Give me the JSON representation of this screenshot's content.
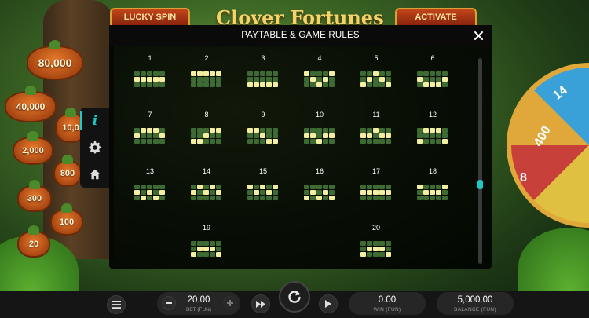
{
  "modal": {
    "title": "PAYTABLE & GAME RULES",
    "close_icon": "close-icon",
    "scroll_position": 0.62,
    "colors": {
      "active": "#f4eea0",
      "inactive": "#3e6a34",
      "accent": "#1ec8c8"
    }
  },
  "paylines": [
    {
      "number": "1",
      "rows": [
        [
          0,
          0,
          0,
          0,
          0
        ],
        [
          1,
          1,
          1,
          1,
          1
        ],
        [
          0,
          0,
          0,
          0,
          0
        ]
      ]
    },
    {
      "number": "2",
      "rows": [
        [
          1,
          1,
          1,
          1,
          1
        ],
        [
          0,
          0,
          0,
          0,
          0
        ],
        [
          0,
          0,
          0,
          0,
          0
        ]
      ]
    },
    {
      "number": "3",
      "rows": [
        [
          0,
          0,
          0,
          0,
          0
        ],
        [
          0,
          0,
          0,
          0,
          0
        ],
        [
          1,
          1,
          1,
          1,
          1
        ]
      ]
    },
    {
      "number": "4",
      "rows": [
        [
          1,
          0,
          0,
          0,
          1
        ],
        [
          0,
          1,
          0,
          1,
          0
        ],
        [
          0,
          0,
          1,
          0,
          0
        ]
      ]
    },
    {
      "number": "5",
      "rows": [
        [
          0,
          0,
          1,
          0,
          0
        ],
        [
          0,
          1,
          0,
          1,
          0
        ],
        [
          1,
          0,
          0,
          0,
          1
        ]
      ]
    },
    {
      "number": "6",
      "rows": [
        [
          0,
          0,
          0,
          0,
          0
        ],
        [
          1,
          0,
          0,
          0,
          1
        ],
        [
          0,
          1,
          1,
          1,
          0
        ]
      ]
    },
    {
      "number": "7",
      "rows": [
        [
          0,
          1,
          1,
          1,
          0
        ],
        [
          1,
          0,
          0,
          0,
          1
        ],
        [
          0,
          0,
          0,
          0,
          0
        ]
      ]
    },
    {
      "number": "8",
      "rows": [
        [
          0,
          0,
          0,
          1,
          1
        ],
        [
          0,
          0,
          1,
          0,
          0
        ],
        [
          1,
          1,
          0,
          0,
          0
        ]
      ]
    },
    {
      "number": "9",
      "rows": [
        [
          1,
          1,
          0,
          0,
          0
        ],
        [
          0,
          0,
          1,
          0,
          0
        ],
        [
          0,
          0,
          0,
          1,
          1
        ]
      ]
    },
    {
      "number": "10",
      "rows": [
        [
          0,
          0,
          0,
          0,
          0
        ],
        [
          1,
          1,
          0,
          1,
          1
        ],
        [
          0,
          0,
          1,
          0,
          0
        ]
      ]
    },
    {
      "number": "11",
      "rows": [
        [
          0,
          0,
          1,
          0,
          0
        ],
        [
          1,
          1,
          0,
          1,
          1
        ],
        [
          0,
          0,
          0,
          0,
          0
        ]
      ]
    },
    {
      "number": "12",
      "rows": [
        [
          0,
          1,
          1,
          1,
          0
        ],
        [
          0,
          0,
          0,
          0,
          0
        ],
        [
          1,
          0,
          0,
          0,
          1
        ]
      ]
    },
    {
      "number": "13",
      "rows": [
        [
          0,
          0,
          0,
          0,
          0
        ],
        [
          1,
          0,
          1,
          0,
          1
        ],
        [
          0,
          1,
          0,
          1,
          0
        ]
      ]
    },
    {
      "number": "14",
      "rows": [
        [
          0,
          1,
          0,
          1,
          0
        ],
        [
          1,
          0,
          1,
          0,
          1
        ],
        [
          0,
          0,
          0,
          0,
          0
        ]
      ]
    },
    {
      "number": "15",
      "rows": [
        [
          1,
          0,
          1,
          0,
          1
        ],
        [
          0,
          1,
          0,
          1,
          0
        ],
        [
          0,
          0,
          0,
          0,
          0
        ]
      ]
    },
    {
      "number": "16",
      "rows": [
        [
          0,
          0,
          0,
          0,
          0
        ],
        [
          0,
          1,
          0,
          1,
          0
        ],
        [
          1,
          0,
          1,
          0,
          1
        ]
      ]
    },
    {
      "number": "17",
      "rows": [
        [
          0,
          0,
          0,
          0,
          0
        ],
        [
          1,
          1,
          1,
          1,
          1
        ],
        [
          0,
          0,
          0,
          0,
          0
        ]
      ]
    },
    {
      "number": "18",
      "rows": [
        [
          1,
          0,
          0,
          0,
          1
        ],
        [
          0,
          1,
          1,
          1,
          0
        ],
        [
          0,
          0,
          0,
          0,
          0
        ]
      ]
    },
    {
      "number": "19",
      "rows": [
        [
          0,
          0,
          0,
          0,
          0
        ],
        [
          0,
          1,
          1,
          1,
          0
        ],
        [
          1,
          0,
          0,
          0,
          1
        ]
      ]
    },
    {
      "number": "20",
      "rows": [
        [
          0,
          0,
          0,
          0,
          0
        ],
        [
          0,
          1,
          1,
          1,
          0
        ],
        [
          1,
          0,
          0,
          0,
          1
        ]
      ]
    }
  ],
  "side_menu": {
    "items": [
      {
        "name": "info",
        "icon": "info-icon",
        "active": true
      },
      {
        "name": "settings",
        "icon": "gear-icon",
        "active": false
      },
      {
        "name": "home",
        "icon": "home-icon",
        "active": false
      }
    ]
  },
  "background": {
    "lucky_spin_label": "LUCKY SPIN",
    "activate_label": "ACTIVATE",
    "game_title": "Clover Fortunes",
    "pumpkins": [
      "80,000",
      "40,000",
      "10,0",
      "2,000",
      "800",
      "300",
      "100",
      "20"
    ],
    "wheel_values": [
      "400",
      "14",
      "8"
    ]
  },
  "bottom_bar": {
    "menu_icon": "hamburger-menu-icon",
    "bet": {
      "value": "20.00",
      "label": "BET (FUN)"
    },
    "win": {
      "value": "0.00",
      "label": "WIN (FUN)"
    },
    "balance": {
      "value": "5,000.00",
      "label": "BALANCE (FUN)"
    }
  }
}
